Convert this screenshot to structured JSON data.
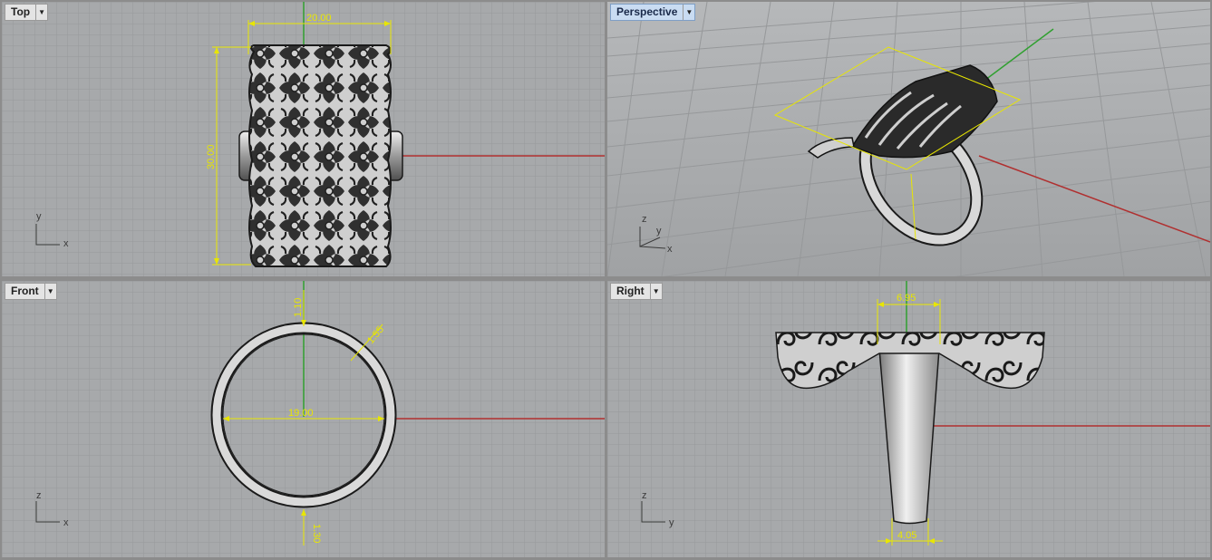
{
  "viewports": {
    "top": {
      "label": "Top",
      "dims": {
        "width": "20.00",
        "height": "30.00"
      },
      "axes": {
        "a": "y",
        "b": "x"
      }
    },
    "perspective": {
      "label": "Perspective",
      "axes": {
        "a": "z",
        "b": "y",
        "c": "x"
      }
    },
    "front": {
      "label": "Front",
      "dims": {
        "top_thick": "1.10",
        "side_thick": "1.55",
        "diameter": "19.00",
        "bottom_thick": "1.30"
      },
      "axes": {
        "a": "z",
        "b": "x"
      }
    },
    "right": {
      "label": "Right",
      "dims": {
        "top_width": "6.95",
        "bottom_width": "4.05"
      },
      "axes": {
        "a": "z",
        "b": "y"
      }
    }
  },
  "colors": {
    "viewport_bg": "#a7a9ab",
    "grid": "#959799",
    "dimension": "#e8e600",
    "x_axis": "#b03030",
    "y_axis": "#30a030"
  },
  "icons": {
    "dropdown": "chevron-down-icon"
  }
}
